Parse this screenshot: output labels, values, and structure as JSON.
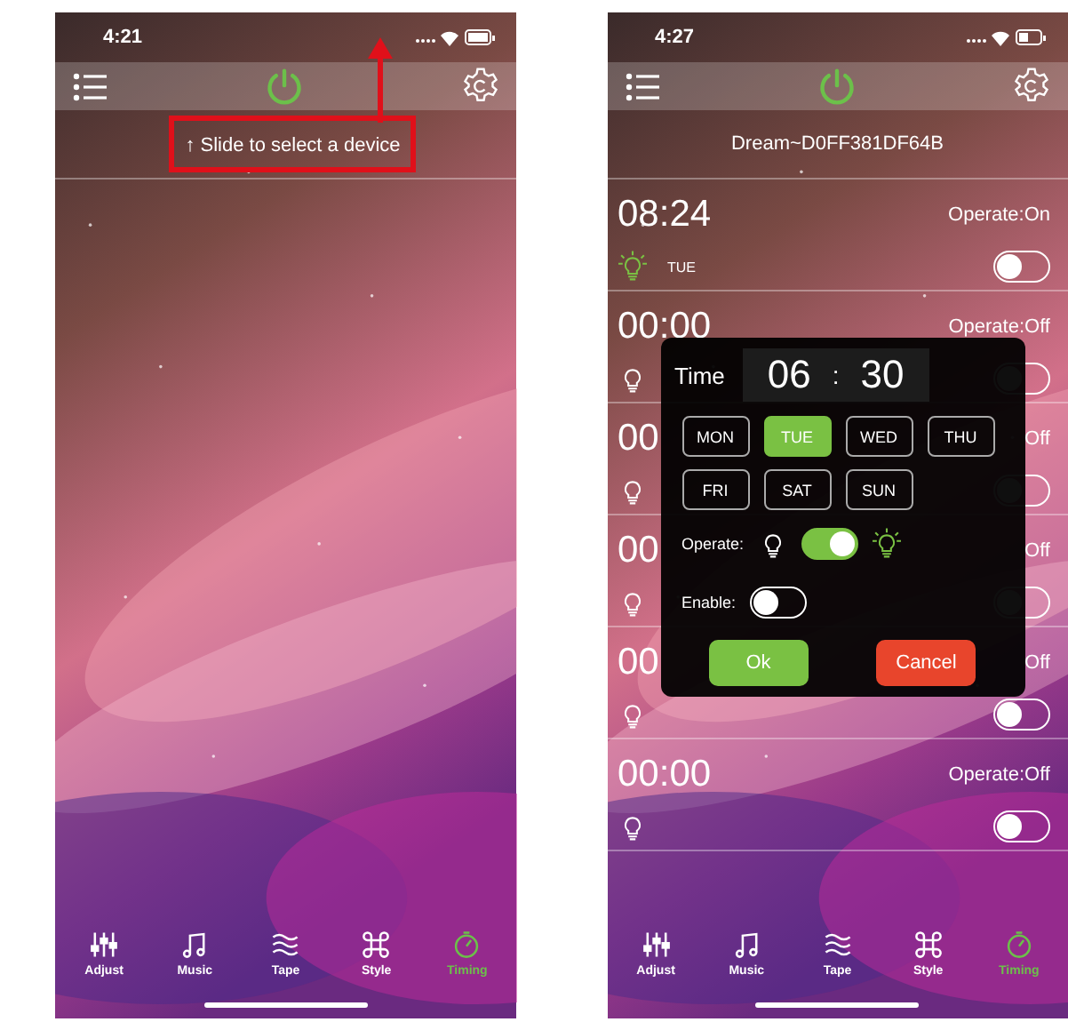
{
  "screens": [
    {
      "status_bar": {
        "time": "4:21"
      },
      "hint": {
        "text": "↑ Slide to select a device",
        "annotated": true
      },
      "tabs": [
        {
          "label": "Adjust",
          "kind": "adjust",
          "selected": false
        },
        {
          "label": "Music",
          "kind": "music",
          "selected": false
        },
        {
          "label": "Tape",
          "kind": "tape",
          "selected": false
        },
        {
          "label": "Style",
          "kind": "style",
          "selected": false
        },
        {
          "label": "Timing",
          "kind": "timing",
          "selected": true
        }
      ]
    },
    {
      "status_bar": {
        "time": "4:27"
      },
      "device_name": "Dream~D0FF381DF64B",
      "timers": [
        {
          "time": "08:24",
          "operate": "Operate:On",
          "light_on": true,
          "days": "TUE",
          "enabled": false
        },
        {
          "time": "00:00",
          "operate": "Operate:Off",
          "light_on": false,
          "enabled": false
        },
        {
          "time": "00",
          "operate": "Off",
          "light_on": false,
          "enabled": false
        },
        {
          "time": "00",
          "operate": "Off",
          "light_on": false,
          "enabled": false
        },
        {
          "time": "00",
          "operate": "Off",
          "light_on": false,
          "enabled": false
        },
        {
          "time": "00:00",
          "operate": "Operate:Off",
          "light_on": false,
          "enabled": false
        }
      ],
      "dialog": {
        "title": "Time",
        "hour": "06",
        "separator": ":",
        "minute": "30",
        "days": [
          {
            "label": "MON",
            "selected": false
          },
          {
            "label": "TUE",
            "selected": true
          },
          {
            "label": "WED",
            "selected": false
          },
          {
            "label": "THU",
            "selected": false
          },
          {
            "label": "FRI",
            "selected": false
          },
          {
            "label": "SAT",
            "selected": false
          },
          {
            "label": "SUN",
            "selected": false
          }
        ],
        "operate_label": "Operate:",
        "operate_on": true,
        "enable_label": "Enable:",
        "enabled": false,
        "buttons": [
          {
            "label": "Ok",
            "kind": "ok"
          },
          {
            "label": "Cancel",
            "kind": "cancel"
          }
        ]
      },
      "tabs": [
        {
          "label": "Adjust",
          "kind": "adjust",
          "selected": false
        },
        {
          "label": "Music",
          "kind": "music",
          "selected": false
        },
        {
          "label": "Tape",
          "kind": "tape",
          "selected": false
        },
        {
          "label": "Style",
          "kind": "style",
          "selected": false
        },
        {
          "label": "Timing",
          "kind": "timing",
          "selected": true
        }
      ]
    }
  ]
}
